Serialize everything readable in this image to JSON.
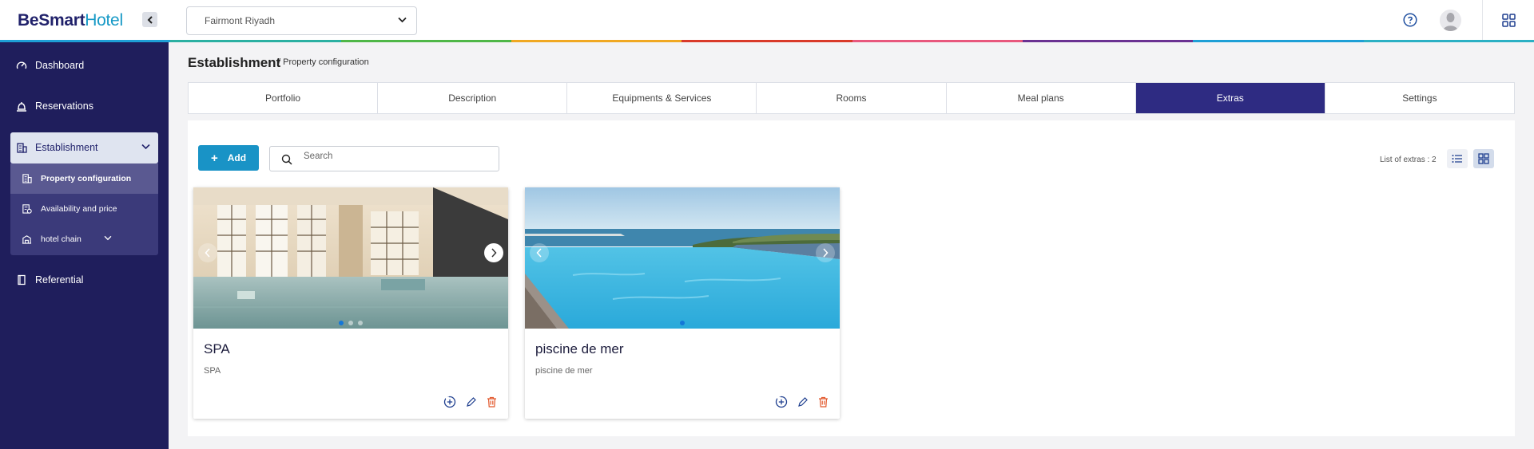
{
  "brand": {
    "be": "BeSmart",
    "hotel": "Hotel"
  },
  "hotel_selector": {
    "value": "Fairmont Riyadh"
  },
  "rainbow_colors": [
    "#1e9fd6",
    "#2bb0a2",
    "#4fb748",
    "#f0a822",
    "#d93a2a",
    "#e8577d",
    "#6a3192",
    "#1e9fd6",
    "#2bb0c4"
  ],
  "sidebar": {
    "items": [
      {
        "label": "Dashboard",
        "icon": "gauge-icon"
      },
      {
        "label": "Reservations",
        "icon": "bell-icon"
      },
      {
        "label": "Referential",
        "icon": "book-icon"
      }
    ],
    "establishment": {
      "label": "Establishment",
      "icon": "building-icon",
      "children": [
        {
          "label": "Property configuration",
          "icon": "building-icon",
          "active": true
        },
        {
          "label": "Availability and price",
          "icon": "price-icon"
        },
        {
          "label": "hotel chain",
          "icon": "hotel-icon"
        }
      ]
    }
  },
  "breadcrumb": {
    "title": "Establishment",
    "sub": "/ Property configuration"
  },
  "tabs": [
    "Portfolio",
    "Description",
    "Equipments & Services",
    "Rooms",
    "Meal plans",
    "Extras",
    "Settings"
  ],
  "active_tab": "Extras",
  "toolbar": {
    "add_label": "Add",
    "search_placeholder": "Search",
    "list_count": "List of extras : 2"
  },
  "extras": [
    {
      "title": "SPA",
      "description": "SPA",
      "image": "spa-pool-photo",
      "slides": 3,
      "current_slide": 0
    },
    {
      "title": "piscine de mer",
      "description": "piscine de mer",
      "image": "infinity-pool-photo",
      "slides": 1,
      "current_slide": 0
    }
  ],
  "colors": {
    "sidebar": "#1f1e5c",
    "accent": "#1993c6",
    "active_tab": "#2e2b82",
    "delete": "#e2572b"
  }
}
